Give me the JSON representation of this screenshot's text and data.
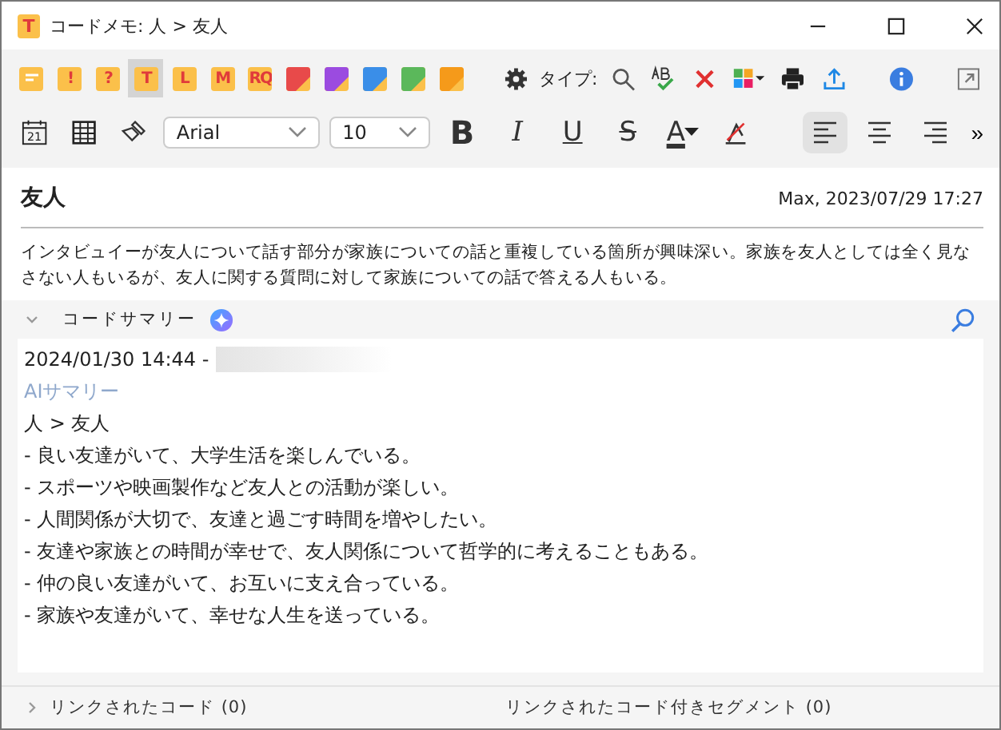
{
  "window": {
    "title": "コードメモ: 人 > 友人",
    "app_icon": "T"
  },
  "memo_types": [
    {
      "kind": "blank",
      "selected": false
    },
    {
      "kind": "letter",
      "label": "!",
      "selected": false
    },
    {
      "kind": "letter",
      "label": "?",
      "selected": false
    },
    {
      "kind": "letter",
      "label": "T",
      "selected": true
    },
    {
      "kind": "letter",
      "label": "L",
      "selected": false
    },
    {
      "kind": "letter",
      "label": "M",
      "selected": false
    },
    {
      "kind": "letter",
      "label": "RQ",
      "selected": false
    },
    {
      "kind": "corner",
      "color": "#e84a4a",
      "selected": false
    },
    {
      "kind": "corner",
      "color": "#9b4be0",
      "selected": false
    },
    {
      "kind": "corner",
      "color": "#3a8ee8",
      "selected": false
    },
    {
      "kind": "corner",
      "color": "#5bb85b",
      "selected": false
    },
    {
      "kind": "corner",
      "color": "#f59a1a",
      "selected": false
    }
  ],
  "type_label": "タイプ:",
  "calendar_day": "21",
  "font": {
    "value": "Arial"
  },
  "size": {
    "value": "10"
  },
  "format_buttons": [
    {
      "kind": "bold",
      "label": "B"
    },
    {
      "kind": "italic",
      "label": "I"
    },
    {
      "kind": "underline",
      "label": "U"
    },
    {
      "kind": "strike",
      "label": "S"
    },
    {
      "kind": "color",
      "label": "A"
    }
  ],
  "align_buttons": [
    {
      "kind": "left",
      "selected": true
    },
    {
      "kind": "center",
      "selected": false
    },
    {
      "kind": "right",
      "selected": false
    }
  ],
  "overflow": "»",
  "memo": {
    "title": "友人",
    "meta": "Max, 2023/07/29 17:27",
    "text": "インタビュイーが友人について話す部分が家族についての話と重複している箇所が興味深い。家族を友人としては全く見なさない人もいるが、友人に関する質問に対して家族についての話で答える人もいる。"
  },
  "summary": {
    "label": "コードサマリー",
    "expanded": true,
    "stamp": "2024/01/30 14:44 -",
    "ai_label": "AIサマリー",
    "code": "人 > 友人",
    "lines": [
      "- 良い友達がいて、大学生活を楽しんでいる。",
      "- スポーツや映画製作など友人との活動が楽しい。",
      "- 人間関係が大切で、友達と過ごす時間を増やしたい。",
      "- 友達や家族との時間が幸せで、友人関係について哲学的に考えることもある。",
      "- 仲の良い友達がいて、お互いに支え合っている。",
      "- 家族や友達がいて、幸せな人生を送っている。"
    ]
  },
  "footer": {
    "expanded": false,
    "linked_codes": "リンクされたコード (0)",
    "linked_segments": "リンクされたコード付きセグメント (0)"
  }
}
